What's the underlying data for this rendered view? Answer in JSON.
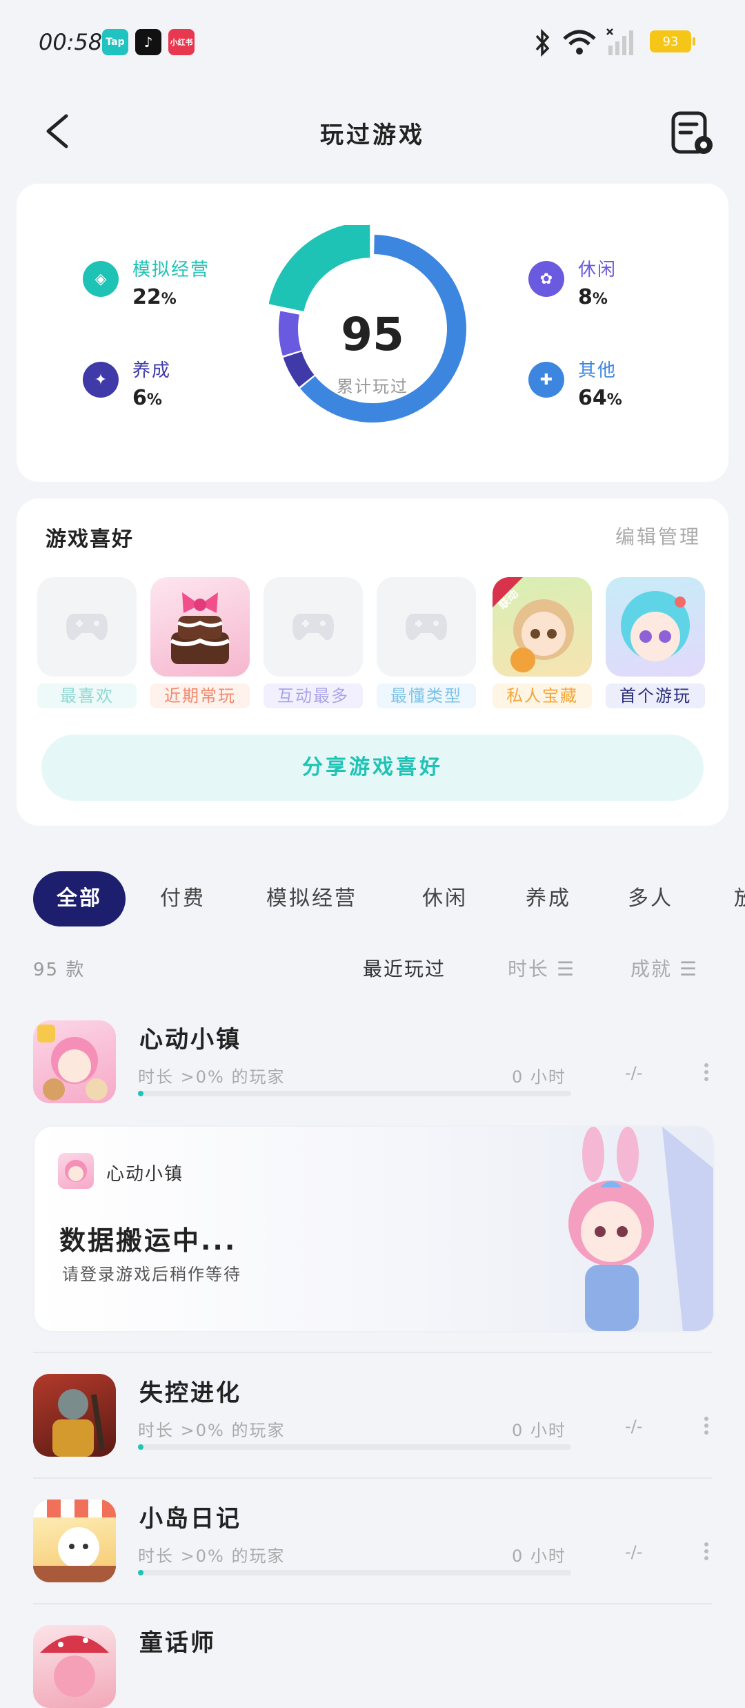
{
  "status_bar": {
    "time": "00:58",
    "apps": [
      "Tap",
      "♪",
      "小红书"
    ],
    "battery": "93"
  },
  "header": {
    "title": "玩过游戏"
  },
  "stats": {
    "total": "95",
    "total_label": "累计玩过",
    "categories": [
      {
        "label": "模拟经营",
        "value": "22",
        "unit": "%",
        "color": "#1fc3b6"
      },
      {
        "label": "养成",
        "value": "6",
        "unit": "%",
        "color": "#3f3aa8"
      },
      {
        "label": "休闲",
        "value": "8",
        "unit": "%",
        "color": "#6a5ae0"
      },
      {
        "label": "其他",
        "value": "64",
        "unit": "%",
        "color": "#3d86e0"
      }
    ]
  },
  "favorites": {
    "title": "游戏喜好",
    "edit": "编辑管理",
    "tiles": [
      {
        "label": "最喜欢",
        "color": "#8fd8d2",
        "bg": "#eefaf9"
      },
      {
        "label": "近期常玩",
        "color": "#f08a6e",
        "bg": "#fff1ec"
      },
      {
        "label": "互动最多",
        "color": "#a9a4e8",
        "bg": "#f2f0ff"
      },
      {
        "label": "最懂类型",
        "color": "#7ec3e8",
        "bg": "#eef7fd"
      },
      {
        "label": "私人宝藏",
        "color": "#f2a73b",
        "bg": "#fff5e4"
      },
      {
        "label": "首个游玩",
        "color": "#2c2f7a",
        "bg": "#eceefb"
      }
    ],
    "corner_tag": "联动",
    "share": "分享游戏喜好"
  },
  "tabs": [
    "全部",
    "付费",
    "模拟经营",
    "休闲",
    "养成",
    "多人",
    "放"
  ],
  "list": {
    "count": "95 款",
    "sorts": [
      "最近玩过",
      "时长 ☰",
      "成就 ☰"
    ]
  },
  "games": [
    {
      "name": "心动小镇",
      "meta": "时长 >0% 的玩家",
      "hours": "0 小时",
      "ach": "-/-"
    },
    {
      "name": "失控进化",
      "meta": "时长 >0% 的玩家",
      "hours": "0 小时",
      "ach": "-/-"
    },
    {
      "name": "小岛日记",
      "meta": "时长 >0% 的玩家",
      "hours": "0 小时",
      "ach": "-/-"
    },
    {
      "name": "童话师"
    }
  ],
  "banner": {
    "game": "心动小镇",
    "title": "数据搬运中...",
    "subtitle": "请登录游戏后稍作等待"
  }
}
